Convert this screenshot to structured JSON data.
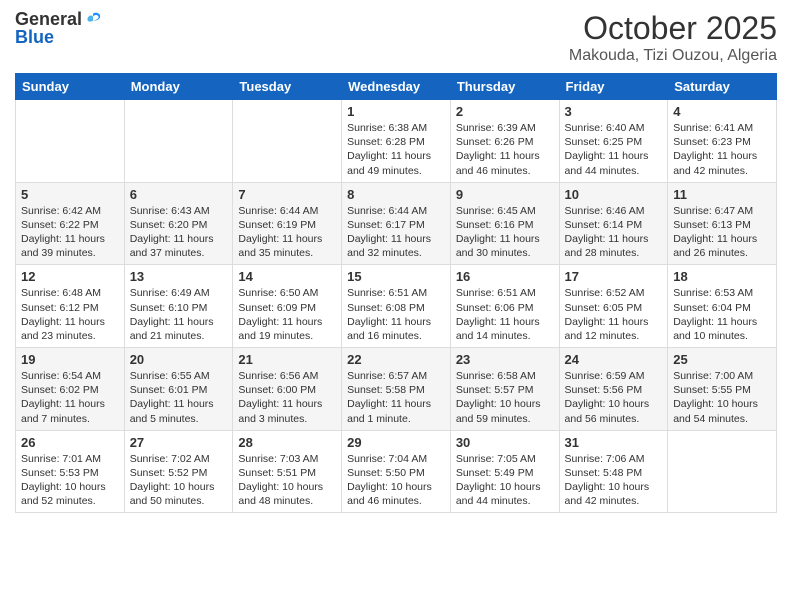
{
  "logo": {
    "general": "General",
    "blue": "Blue"
  },
  "header": {
    "month": "October 2025",
    "location": "Makouda, Tizi Ouzou, Algeria"
  },
  "weekdays": [
    "Sunday",
    "Monday",
    "Tuesday",
    "Wednesday",
    "Thursday",
    "Friday",
    "Saturday"
  ],
  "weeks": [
    [
      {
        "day": "",
        "sunrise": "",
        "sunset": "",
        "daylight": ""
      },
      {
        "day": "",
        "sunrise": "",
        "sunset": "",
        "daylight": ""
      },
      {
        "day": "",
        "sunrise": "",
        "sunset": "",
        "daylight": ""
      },
      {
        "day": "1",
        "sunrise": "Sunrise: 6:38 AM",
        "sunset": "Sunset: 6:28 PM",
        "daylight": "Daylight: 11 hours and 49 minutes."
      },
      {
        "day": "2",
        "sunrise": "Sunrise: 6:39 AM",
        "sunset": "Sunset: 6:26 PM",
        "daylight": "Daylight: 11 hours and 46 minutes."
      },
      {
        "day": "3",
        "sunrise": "Sunrise: 6:40 AM",
        "sunset": "Sunset: 6:25 PM",
        "daylight": "Daylight: 11 hours and 44 minutes."
      },
      {
        "day": "4",
        "sunrise": "Sunrise: 6:41 AM",
        "sunset": "Sunset: 6:23 PM",
        "daylight": "Daylight: 11 hours and 42 minutes."
      }
    ],
    [
      {
        "day": "5",
        "sunrise": "Sunrise: 6:42 AM",
        "sunset": "Sunset: 6:22 PM",
        "daylight": "Daylight: 11 hours and 39 minutes."
      },
      {
        "day": "6",
        "sunrise": "Sunrise: 6:43 AM",
        "sunset": "Sunset: 6:20 PM",
        "daylight": "Daylight: 11 hours and 37 minutes."
      },
      {
        "day": "7",
        "sunrise": "Sunrise: 6:44 AM",
        "sunset": "Sunset: 6:19 PM",
        "daylight": "Daylight: 11 hours and 35 minutes."
      },
      {
        "day": "8",
        "sunrise": "Sunrise: 6:44 AM",
        "sunset": "Sunset: 6:17 PM",
        "daylight": "Daylight: 11 hours and 32 minutes."
      },
      {
        "day": "9",
        "sunrise": "Sunrise: 6:45 AM",
        "sunset": "Sunset: 6:16 PM",
        "daylight": "Daylight: 11 hours and 30 minutes."
      },
      {
        "day": "10",
        "sunrise": "Sunrise: 6:46 AM",
        "sunset": "Sunset: 6:14 PM",
        "daylight": "Daylight: 11 hours and 28 minutes."
      },
      {
        "day": "11",
        "sunrise": "Sunrise: 6:47 AM",
        "sunset": "Sunset: 6:13 PM",
        "daylight": "Daylight: 11 hours and 26 minutes."
      }
    ],
    [
      {
        "day": "12",
        "sunrise": "Sunrise: 6:48 AM",
        "sunset": "Sunset: 6:12 PM",
        "daylight": "Daylight: 11 hours and 23 minutes."
      },
      {
        "day": "13",
        "sunrise": "Sunrise: 6:49 AM",
        "sunset": "Sunset: 6:10 PM",
        "daylight": "Daylight: 11 hours and 21 minutes."
      },
      {
        "day": "14",
        "sunrise": "Sunrise: 6:50 AM",
        "sunset": "Sunset: 6:09 PM",
        "daylight": "Daylight: 11 hours and 19 minutes."
      },
      {
        "day": "15",
        "sunrise": "Sunrise: 6:51 AM",
        "sunset": "Sunset: 6:08 PM",
        "daylight": "Daylight: 11 hours and 16 minutes."
      },
      {
        "day": "16",
        "sunrise": "Sunrise: 6:51 AM",
        "sunset": "Sunset: 6:06 PM",
        "daylight": "Daylight: 11 hours and 14 minutes."
      },
      {
        "day": "17",
        "sunrise": "Sunrise: 6:52 AM",
        "sunset": "Sunset: 6:05 PM",
        "daylight": "Daylight: 11 hours and 12 minutes."
      },
      {
        "day": "18",
        "sunrise": "Sunrise: 6:53 AM",
        "sunset": "Sunset: 6:04 PM",
        "daylight": "Daylight: 11 hours and 10 minutes."
      }
    ],
    [
      {
        "day": "19",
        "sunrise": "Sunrise: 6:54 AM",
        "sunset": "Sunset: 6:02 PM",
        "daylight": "Daylight: 11 hours and 7 minutes."
      },
      {
        "day": "20",
        "sunrise": "Sunrise: 6:55 AM",
        "sunset": "Sunset: 6:01 PM",
        "daylight": "Daylight: 11 hours and 5 minutes."
      },
      {
        "day": "21",
        "sunrise": "Sunrise: 6:56 AM",
        "sunset": "Sunset: 6:00 PM",
        "daylight": "Daylight: 11 hours and 3 minutes."
      },
      {
        "day": "22",
        "sunrise": "Sunrise: 6:57 AM",
        "sunset": "Sunset: 5:58 PM",
        "daylight": "Daylight: 11 hours and 1 minute."
      },
      {
        "day": "23",
        "sunrise": "Sunrise: 6:58 AM",
        "sunset": "Sunset: 5:57 PM",
        "daylight": "Daylight: 10 hours and 59 minutes."
      },
      {
        "day": "24",
        "sunrise": "Sunrise: 6:59 AM",
        "sunset": "Sunset: 5:56 PM",
        "daylight": "Daylight: 10 hours and 56 minutes."
      },
      {
        "day": "25",
        "sunrise": "Sunrise: 7:00 AM",
        "sunset": "Sunset: 5:55 PM",
        "daylight": "Daylight: 10 hours and 54 minutes."
      }
    ],
    [
      {
        "day": "26",
        "sunrise": "Sunrise: 7:01 AM",
        "sunset": "Sunset: 5:53 PM",
        "daylight": "Daylight: 10 hours and 52 minutes."
      },
      {
        "day": "27",
        "sunrise": "Sunrise: 7:02 AM",
        "sunset": "Sunset: 5:52 PM",
        "daylight": "Daylight: 10 hours and 50 minutes."
      },
      {
        "day": "28",
        "sunrise": "Sunrise: 7:03 AM",
        "sunset": "Sunset: 5:51 PM",
        "daylight": "Daylight: 10 hours and 48 minutes."
      },
      {
        "day": "29",
        "sunrise": "Sunrise: 7:04 AM",
        "sunset": "Sunset: 5:50 PM",
        "daylight": "Daylight: 10 hours and 46 minutes."
      },
      {
        "day": "30",
        "sunrise": "Sunrise: 7:05 AM",
        "sunset": "Sunset: 5:49 PM",
        "daylight": "Daylight: 10 hours and 44 minutes."
      },
      {
        "day": "31",
        "sunrise": "Sunrise: 7:06 AM",
        "sunset": "Sunset: 5:48 PM",
        "daylight": "Daylight: 10 hours and 42 minutes."
      },
      {
        "day": "",
        "sunrise": "",
        "sunset": "",
        "daylight": ""
      }
    ]
  ]
}
